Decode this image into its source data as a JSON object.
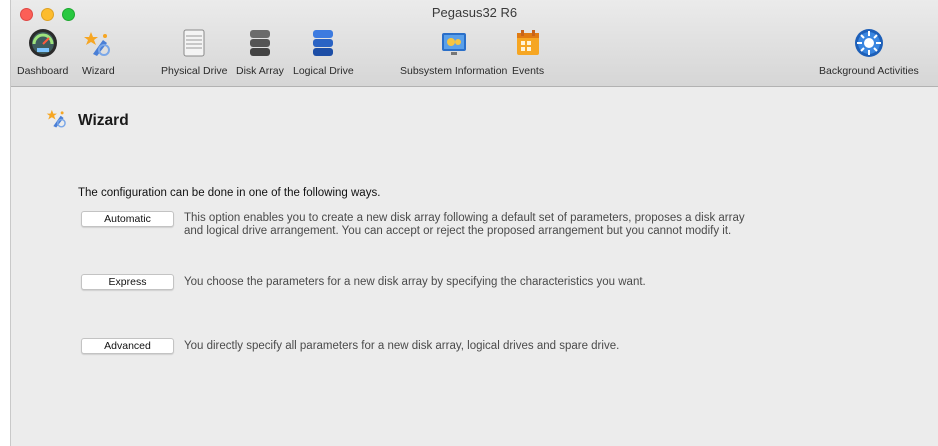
{
  "window": {
    "title": "Pegasus32 R6"
  },
  "toolbar": {
    "items": [
      {
        "label": "Dashboard",
        "icon": "dashboard-gauge-icon"
      },
      {
        "label": "Wizard",
        "icon": "wizard-icon"
      },
      {
        "label": "Physical Drive",
        "icon": "physical-drive-icon"
      },
      {
        "label": "Disk Array",
        "icon": "disk-array-icon"
      },
      {
        "label": "Logical Drive",
        "icon": "logical-drive-icon"
      },
      {
        "label": "Subsystem Information",
        "icon": "subsystem-information-icon"
      },
      {
        "label": "Events",
        "icon": "events-calendar-icon"
      },
      {
        "label": "Background Activities",
        "icon": "background-activities-icon"
      }
    ]
  },
  "main": {
    "heading": "Wizard",
    "intro": "The configuration can be done in one of the following ways.",
    "options": [
      {
        "button": "Automatic",
        "description": "This option enables you to create a new disk array following a default set of parameters, proposes a disk array and logical drive arrangement. You can accept or reject the proposed arrangement but you cannot modify it."
      },
      {
        "button": "Express",
        "description": "You choose the parameters for a new disk array by specifying the characteristics you want."
      },
      {
        "button": "Advanced",
        "description": "You directly specify all parameters for a new disk array, logical drives and spare drive."
      }
    ]
  },
  "colors": {
    "window_bg": "#ececec",
    "close": "#fc5f57",
    "minimize": "#fdbc2e",
    "zoom": "#28c840"
  }
}
